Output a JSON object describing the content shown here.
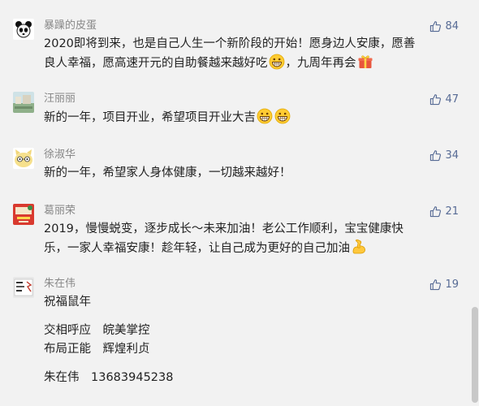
{
  "comments": [
    {
      "name": "暴躁的皮蛋",
      "likes": "84",
      "avatar_icon": "panda-avatar-icon",
      "lines": [
        "2020即将到来，也是自己人生一个新阶段的开始！愿身边人安康，愿善",
        "良人幸福，愿高速开元的自助餐越来越好吃",
        "，九周年再会"
      ]
    },
    {
      "name": "汪丽丽",
      "likes": "47",
      "avatar_icon": "landscape-avatar-icon",
      "lines": [
        "新的一年，项目开业，希望项目开业大吉"
      ]
    },
    {
      "name": "徐淑华",
      "likes": "34",
      "avatar_icon": "cartoon-face-avatar-icon",
      "lines": [
        "新的一年，希望家人身体健康，一切越来越好！"
      ]
    },
    {
      "name": "葛丽荣",
      "likes": "21",
      "avatar_icon": "red-card-avatar-icon",
      "lines": [
        "2019，慢慢蜕变，逐步成长～未来加油！老公工作顺利，宝宝健康快",
        "乐，一家人幸福安康！趁年轻，让自己成为更好的自己加油"
      ]
    },
    {
      "name": "朱在伟",
      "likes": "19",
      "avatar_icon": "poster-avatar-icon",
      "lines": [
        "祝福鼠年",
        "",
        "交相呼应　皖美掌控",
        "布局正能　辉煌利贞",
        "",
        "朱在伟　13683945238"
      ]
    }
  ],
  "icons": {
    "like": "thumbs-up-icon",
    "grin": "grinning-emoji-icon",
    "gift": "gift-emoji-icon",
    "muscle": "flexed-biceps-emoji-icon"
  },
  "colors": {
    "background": "#f2f2f2",
    "name": "#888888",
    "like": "#576b95",
    "text": "#222222"
  }
}
